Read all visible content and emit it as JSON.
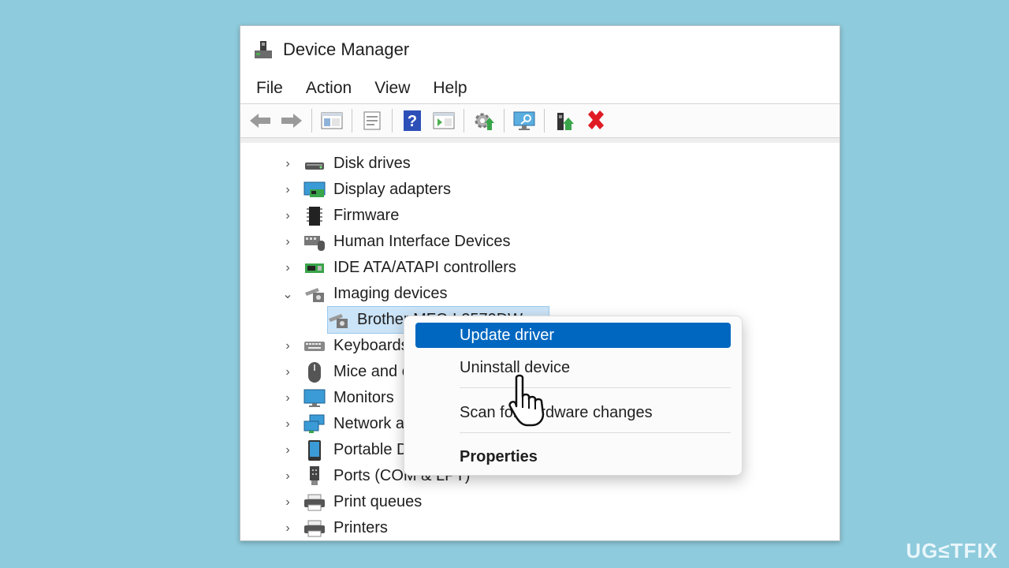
{
  "window": {
    "title": "Device Manager"
  },
  "menu": [
    "File",
    "Action",
    "View",
    "Help"
  ],
  "toolbar": {
    "icons": [
      "back-arrow-icon",
      "forward-arrow-icon",
      "show-hide-console-tree-icon",
      "properties-icon",
      "help-icon",
      "action-pane-icon",
      "update-driver-software-icon",
      "scan-hardware-icon",
      "enable-device-icon",
      "uninstall-icon"
    ]
  },
  "tree": {
    "items": [
      {
        "label": "Disk drives",
        "icon": "disk-drive-icon",
        "expanded": false
      },
      {
        "label": "Display adapters",
        "icon": "display-adapter-icon",
        "expanded": false
      },
      {
        "label": "Firmware",
        "icon": "firmware-icon",
        "expanded": false
      },
      {
        "label": "Human Interface Devices",
        "icon": "hid-icon",
        "expanded": false
      },
      {
        "label": "IDE ATA/ATAPI controllers",
        "icon": "ide-controller-icon",
        "expanded": false
      },
      {
        "label": "Imaging devices",
        "icon": "camera-icon",
        "expanded": true
      },
      {
        "label": "Brother MFC-L2570DW",
        "icon": "camera-icon",
        "child": true
      },
      {
        "label": "Keyboards",
        "icon": "keyboard-icon",
        "expanded": false
      },
      {
        "label": "Mice and other pointing devices",
        "icon": "mouse-icon",
        "expanded": false
      },
      {
        "label": "Monitors",
        "icon": "monitor-icon",
        "expanded": false
      },
      {
        "label": "Network adapters",
        "icon": "network-adapter-icon",
        "expanded": false
      },
      {
        "label": "Portable Devices",
        "icon": "portable-device-icon",
        "expanded": false
      },
      {
        "label": "Ports (COM & LPT)",
        "icon": "port-icon",
        "expanded": false
      },
      {
        "label": "Print queues",
        "icon": "printer-icon",
        "expanded": false
      },
      {
        "label": "Printers",
        "icon": "printer-icon",
        "expanded": false
      }
    ],
    "chevron_collapsed": "›",
    "chevron_expanded": "⌄"
  },
  "context_menu": {
    "items": [
      {
        "label": "Update driver",
        "highlighted": true
      },
      {
        "label": "Uninstall device"
      },
      {
        "label": "Scan for hardware changes"
      },
      {
        "label": "Properties",
        "bold": true
      }
    ]
  },
  "watermark": "UG≤TFIX",
  "colors": {
    "background": "#8ecbdc",
    "highlight": "#0067c0",
    "selection": "#cce4f7",
    "uninstall_red": "#e01b24"
  }
}
